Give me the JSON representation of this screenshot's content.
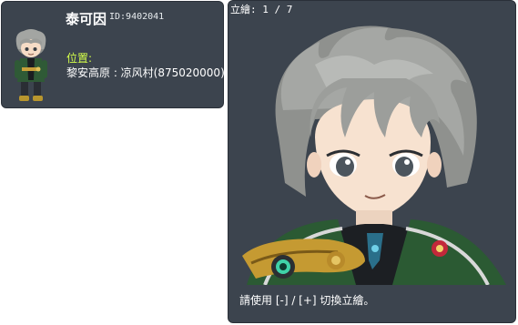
{
  "npc": {
    "name": "泰可因",
    "id_text": "ID:9402041",
    "location_label": "位置:",
    "location_value": "黎安高原 : 凉风村(875020000)"
  },
  "portrait": {
    "counter": "立繪: 1 / 7",
    "hint": "請使用 [-] / [+] 切換立繪。"
  },
  "colors": {
    "panel_bg": "#3c444e",
    "location_label": "#d4ff4a",
    "text": "#ffffff"
  }
}
